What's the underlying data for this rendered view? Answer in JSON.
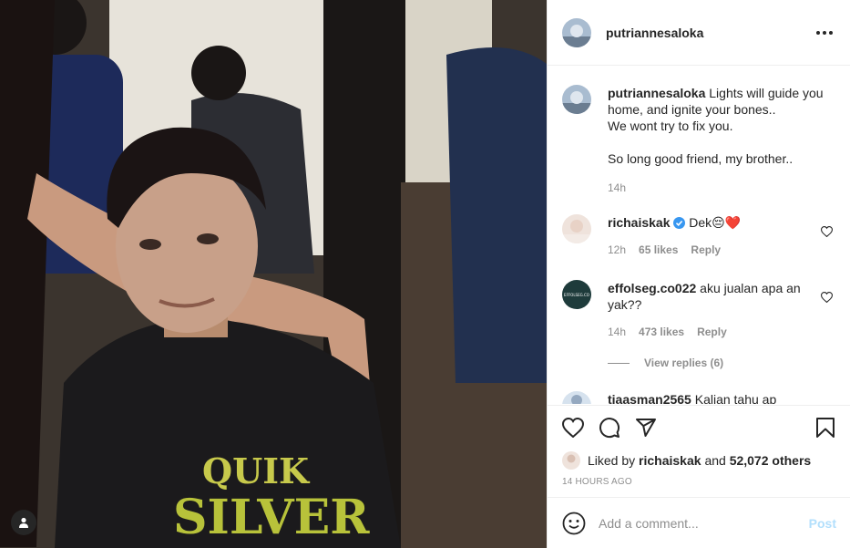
{
  "post": {
    "username": "putriannesaloka",
    "caption_lines": [
      "Lights will guide you",
      "home, and ignite your bones..",
      "We wont try to fix you.",
      "",
      "So long good friend, my brother.."
    ],
    "caption_time": "14h",
    "photo_shirt_text": [
      "QUIK",
      "SILVER"
    ]
  },
  "comments": [
    {
      "username": "richaiskak",
      "verified": true,
      "text": "Dek😔❤️",
      "time": "12h",
      "likes": "65 likes",
      "reply": "Reply"
    },
    {
      "username": "effolseg.co022",
      "verified": false,
      "text": "aku jualan apa an yak??",
      "time": "14h",
      "likes": "473 likes",
      "reply": "Reply",
      "view_replies": "View replies (6)",
      "avatar_text": "EFFOLSEG.CO"
    },
    {
      "username": "tiaasman2565",
      "text": "Kalian tahu ap"
    }
  ],
  "likes": {
    "prefix": "Liked by",
    "user": "richaiskak",
    "and": "and",
    "count": "52,072 others"
  },
  "timestamp": "14 HOURS AGO",
  "add_comment": {
    "placeholder": "Add a comment...",
    "post_label": "Post"
  },
  "colors": {
    "accent_blue": "#3897f0",
    "post_disabled": "#b2dffc",
    "muted": "#8e8e8e",
    "text": "#262626",
    "heart_red": "#ed4956"
  },
  "icons": [
    "more-icon",
    "heart-icon",
    "comment-icon",
    "share-icon",
    "bookmark-icon",
    "emoji-icon",
    "user-tag-icon",
    "verified-icon"
  ]
}
